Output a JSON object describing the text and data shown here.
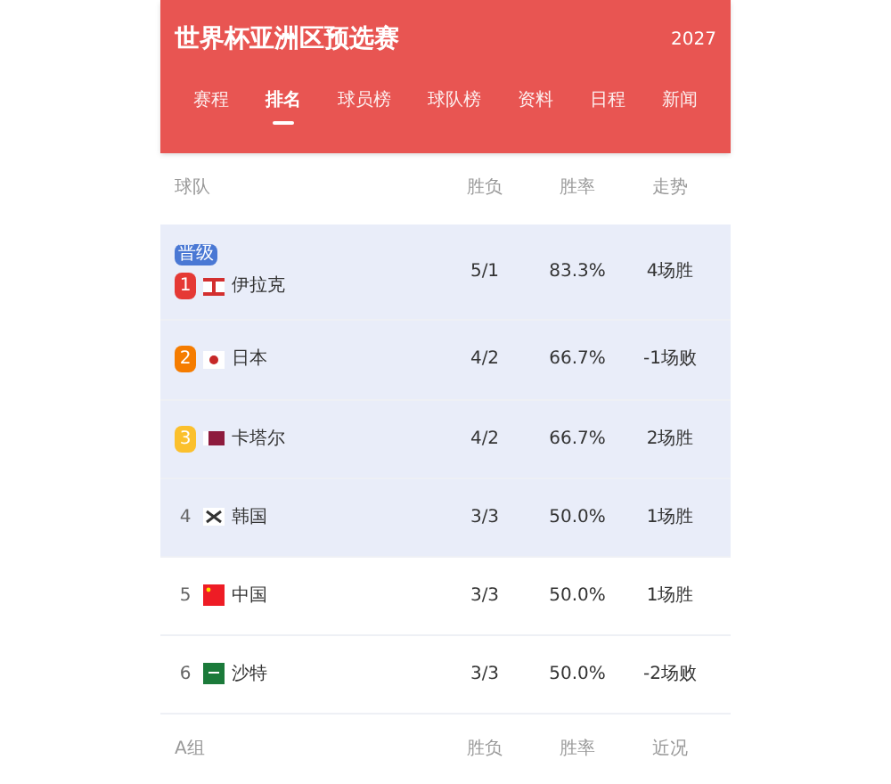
{
  "header": {
    "title": "世界杯亚洲区预选赛",
    "year": "2027"
  },
  "tabs": [
    {
      "label": "赛程",
      "selected": false
    },
    {
      "label": "排名",
      "selected": true
    },
    {
      "label": "球员榜",
      "selected": false
    },
    {
      "label": "球队榜",
      "selected": false
    },
    {
      "label": "资料",
      "selected": false
    },
    {
      "label": "日程",
      "selected": false
    },
    {
      "label": "新闻",
      "selected": false
    }
  ],
  "table": {
    "columns": [
      "球队",
      "胜负",
      "胜率",
      "走势"
    ],
    "rows": [
      {
        "rank": "1",
        "color": "#e53935",
        "team": "伊拉克",
        "record": "5/1",
        "pct": "83.3%",
        "trend": "4场胜",
        "highlighted": true,
        "badge": "晋级"
      },
      {
        "rank": "2",
        "color": "#f57c00",
        "team": "日本",
        "record": "4/2",
        "pct": "66.7%",
        "trend": "-1场败",
        "highlighted": true
      },
      {
        "rank": "3",
        "color": "#fbc02d",
        "team": "卡塔尔",
        "record": "4/2",
        "pct": "66.7%",
        "trend": "2场胜",
        "highlighted": true
      },
      {
        "rank": "4",
        "team": "韩国",
        "record": "3/3",
        "pct": "50.0%",
        "trend": "1场胜",
        "highlighted": true
      },
      {
        "rank": "5",
        "team": "中国",
        "record": "3/3",
        "pct": "50.0%",
        "trend": "1场胜",
        "highlighted": false
      },
      {
        "rank": "6",
        "team": "沙特",
        "record": "3/3",
        "pct": "50.0%",
        "trend": "-2场败",
        "highlighted": false
      }
    ]
  },
  "next_group": {
    "columns": [
      "A组",
      "胜负",
      "胜率",
      "近况"
    ]
  }
}
